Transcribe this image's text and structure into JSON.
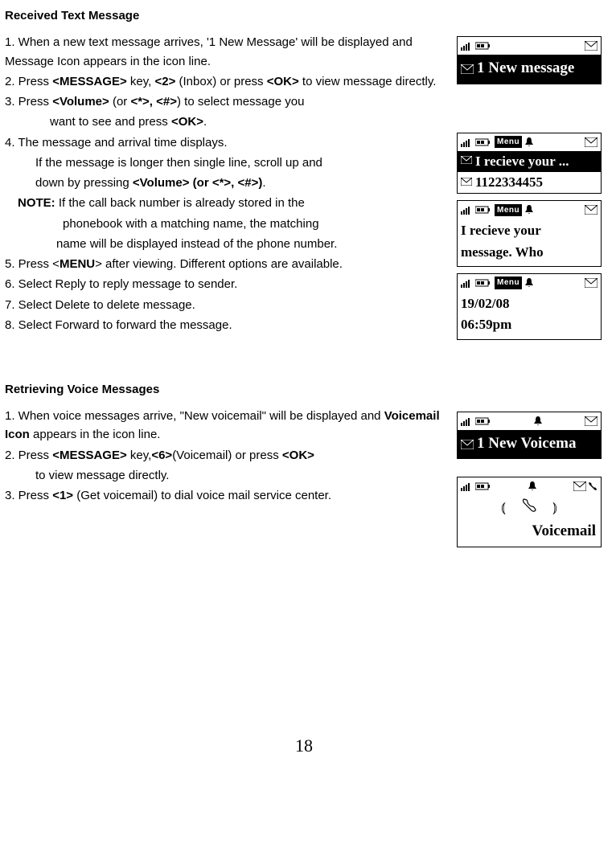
{
  "section1": {
    "title": "Received Text Message",
    "p1a": "  1. When a new text message arrives, '1 New Message' will be displayed and Message Icon appears in the icon line.",
    "p2a": "  2. Press ",
    "p2b": "<MESSAGE>",
    "p2c": " key,  ",
    "p2d": "<2>",
    "p2e": " (Inbox) or press ",
    "p2f": "<OK>",
    "p2g": " to view message directly.",
    "p3a": "   3. Press ",
    "p3b": "<Volume>",
    "p3c": " (or ",
    "p3d": "<*>, <#>",
    "p3e": ") to select message you",
    "p3f": "want to see and  press ",
    "p3g": "<OK>",
    "p3h": ".",
    "p4a": "   4. The message and arrival time displays.",
    "p4b": "If the message   is longer then single line, scroll up and",
    "p4c": "down by pressing ",
    "p4d": "<Volume> (or <*>, <#>)",
    "p4e": ".",
    "noteLabel": "NOTE:",
    "noteA": " If the call back number is already stored in the",
    "noteB": "phonebook with a matching name, the matching",
    "noteC": "name will be displayed instead of the phone number.",
    "p5a": " 5. Press <",
    "p5b": "MENU",
    "p5c": "> after viewing. Different options are available.",
    "p6": " 6. Select Reply to reply message to sender.",
    "p7": " 7. Select Delete to delete message.",
    "p8": " 8. Select Forward to forward the message."
  },
  "section2": {
    "title": "Retrieving Voice Messages",
    "p1": "          1. When voice messages arrive, \"New voicemail\" will be displayed and ",
    "p1b": "Voicemail Icon",
    "p1c": " appears in the icon line.",
    "p2a": "   2. Press  ",
    "p2b": "<MESSAGE>",
    "p2c": " key,",
    "p2d": "<6>",
    "p2e": "(Voicemail) or press ",
    "p2f": "<OK>",
    "p2g": "to view  message directly.",
    "p3a": "   3. Press ",
    "p3b": "<1>",
    "p3c": " (Get voicemail) to dial voice mail service center."
  },
  "screens": {
    "s1": "1 New message",
    "s2a": "I recieve your ...",
    "s2b": "1122334455",
    "s3a": "I recieve your",
    "s3b": "message. Who",
    "s4a": "19/02/08",
    "s4b": "06:59pm",
    "s5": "1 New Voicema",
    "s6": "Voicemail",
    "menuLabel": "Menu"
  },
  "pageNumber": "18"
}
